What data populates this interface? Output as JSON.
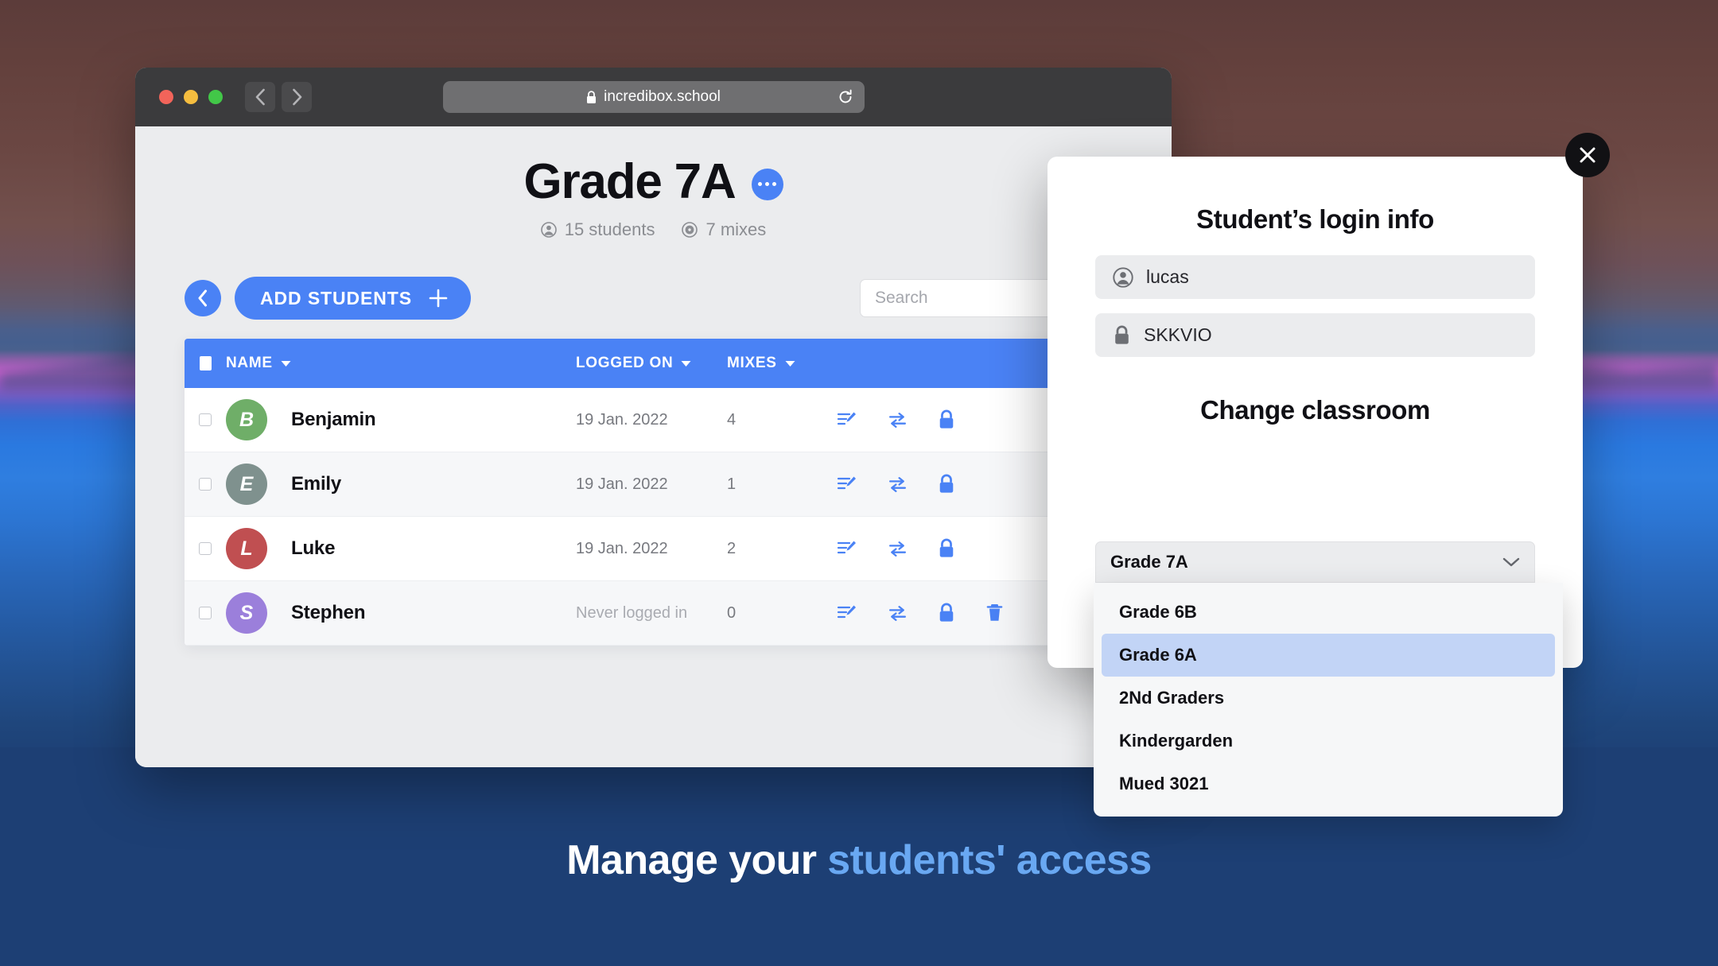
{
  "browser": {
    "url": "incredibox.school",
    "lock_icon": "lock-icon",
    "reload_icon": "reload-icon",
    "back_icon": "chevron-left-icon",
    "forward_icon": "chevron-right-icon"
  },
  "header": {
    "title": "Grade 7A",
    "students_count": "15 students",
    "mixes_count": "7 mixes",
    "more_badge": "ellipsis-badge"
  },
  "toolbar": {
    "back_label": "back",
    "add_students_label": "ADD STUDENTS",
    "search_placeholder": "Search",
    "search_value": ""
  },
  "table": {
    "columns": {
      "name": "NAME",
      "logged_on": "LOGGED ON",
      "mixes": "MIXES"
    },
    "rows": [
      {
        "initial": "B",
        "name": "Benjamin",
        "logged_on": "19 Jan. 2022",
        "mixes": "4",
        "color": "#6fae68",
        "never": false,
        "has_delete": false
      },
      {
        "initial": "E",
        "name": "Emily",
        "logged_on": "19 Jan. 2022",
        "mixes": "1",
        "color": "#7f918e",
        "never": false,
        "has_delete": false
      },
      {
        "initial": "L",
        "name": "Luke",
        "logged_on": "19 Jan. 2022",
        "mixes": "2",
        "color": "#c04f51",
        "never": false,
        "has_delete": false
      },
      {
        "initial": "S",
        "name": "Stephen",
        "logged_on": "Never logged in",
        "mixes": "0",
        "color": "#9b7fdb",
        "never": true,
        "has_delete": true
      }
    ]
  },
  "modal": {
    "login_heading": "Student’s login info",
    "username": "lucas",
    "password": "SKKVIO",
    "classroom_heading": "Change classroom",
    "selected_classroom": "Grade 7A",
    "options": [
      {
        "label": "Grade 6B",
        "selected": false
      },
      {
        "label": "Grade 6A",
        "selected": true
      },
      {
        "label": "2Nd Graders",
        "selected": false
      },
      {
        "label": "Kindergarden",
        "selected": false
      },
      {
        "label": "Mued 3021",
        "selected": false
      }
    ],
    "close_icon": "close-icon"
  },
  "caption": {
    "lead": "Manage your ",
    "accent": "students' access"
  },
  "colors": {
    "accent_blue": "#4a82f5",
    "caption_accent": "#69a8f2",
    "page_bg": "#ebecee",
    "footer_bg": "#1d3f74"
  }
}
